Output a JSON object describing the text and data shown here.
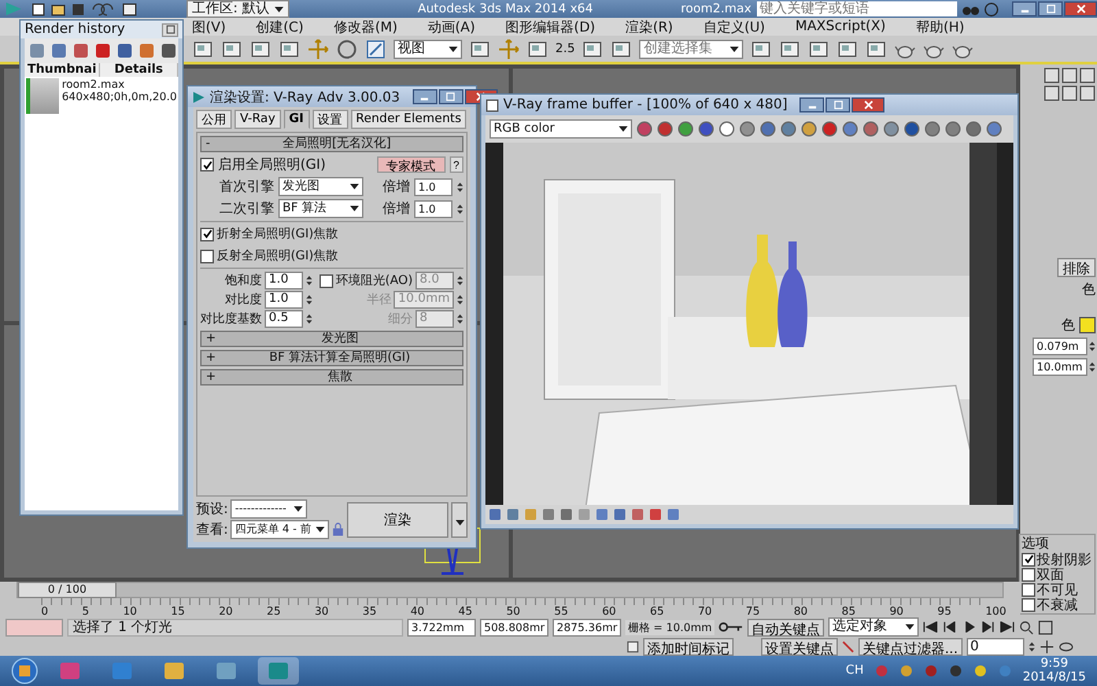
{
  "app": {
    "workspace": "工作区: 默认",
    "title": "Autodesk 3ds Max  2014 x64",
    "file": "room2.max",
    "search": {
      "placeholder": "键入关键字或短语"
    }
  },
  "menu": [
    {
      "label": "图(V)"
    },
    {
      "label": "创建(C)"
    },
    {
      "label": "修改器(M)"
    },
    {
      "label": "动画(A)"
    },
    {
      "label": "图形编辑器(D)"
    },
    {
      "label": "渲染(R)"
    },
    {
      "label": "自定义(U)"
    },
    {
      "label": "MAXScript(X)"
    },
    {
      "label": "帮助(H)"
    }
  ],
  "toolbar": {
    "view": "视图",
    "snap": "2.5",
    "selection_set": {
      "placeholder": "创建选择集"
    }
  },
  "render_history": {
    "title": "Render history",
    "columns": [
      "Thumbnai",
      "Details"
    ],
    "rows": [
      {
        "name": "room2.max",
        "details": "640x480;0h,0m,20.0"
      }
    ]
  },
  "render_settings": {
    "title": "渲染设置: V-Ray Adv 3.00.03",
    "tabs": [
      {
        "label": "公用",
        "selected": false
      },
      {
        "label": "V-Ray",
        "selected": false
      },
      {
        "label": "GI",
        "selected": true
      },
      {
        "label": "设置",
        "selected": false
      },
      {
        "label": "Render Elements",
        "selected": false
      }
    ],
    "rollout": {
      "toggle": "-",
      "title": "全局照明[无名汉化]"
    },
    "enable_gi": {
      "label": "启用全局照明(GI)",
      "checked": true
    },
    "expert_button": "专家模式",
    "help_button": "?",
    "engines": [
      {
        "label": "首次引擎",
        "value": "发光图",
        "mult_label": "倍增",
        "mult": "1.0"
      },
      {
        "label": "二次引擎",
        "value": "BF 算法",
        "mult_label": "倍增",
        "mult": "1.0"
      }
    ],
    "caustics": [
      {
        "label": "折射全局照明(GI)焦散",
        "checked": true
      },
      {
        "label": "反射全局照明(GI)焦散",
        "checked": false
      }
    ],
    "params": [
      {
        "label": "饱和度",
        "value": "1.0"
      },
      {
        "label": "对比度",
        "value": "1.0"
      },
      {
        "label": "对比度基数",
        "value": "0.5"
      }
    ],
    "ao": {
      "label": "环境阻光(AO)",
      "checked": false,
      "value": "8.0",
      "radius_label": "半径",
      "radius": "10.0mm",
      "subdiv_label": "细分",
      "subdiv": "8"
    },
    "collapsed": [
      {
        "toggle": "+",
        "title": "发光图"
      },
      {
        "toggle": "+",
        "title": "BF 算法计算全局照明(GI)"
      },
      {
        "toggle": "+",
        "title": "焦散"
      }
    ],
    "preset": {
      "label": "预设:",
      "value": "-------------"
    },
    "view": {
      "label": "查看:",
      "value": "四元菜单 4 - 前"
    },
    "render_button": "渲染"
  },
  "frame_buffer": {
    "title": "V-Ray frame buffer - [100% of 640 x 480]",
    "channel": "RGB color"
  },
  "command_panel": {
    "exclude_button": "排除",
    "color_labels": [
      "色",
      "色"
    ],
    "fields": [
      "0.079m",
      "10.0mm"
    ],
    "options": {
      "title": "选项",
      "items": [
        {
          "label": "投射阴影",
          "checked": true
        },
        {
          "label": "双面",
          "checked": false
        },
        {
          "label": "不可见",
          "checked": false
        },
        {
          "label": "不衰减",
          "checked": false
        }
      ]
    }
  },
  "timeline": {
    "position": "0 / 100",
    "level": 0,
    "ticks": [
      "0",
      "5",
      "10",
      "15",
      "20",
      "25",
      "30",
      "35",
      "40",
      "45",
      "50",
      "55",
      "60",
      "65",
      "70",
      "75",
      "80",
      "85",
      "90",
      "95",
      "100"
    ]
  },
  "status": {
    "message": "选择了 1 个灯光",
    "x": "3.722mm",
    "y": "508.808mr",
    "z": "2875.36mr",
    "grid": "栅格 = 10.0mm",
    "add_time_tag": "添加时间标记",
    "auto_key": "自动关键点",
    "key_target": "选定对象",
    "set_key": "设置关键点",
    "key_filters": "关键点过滤器...",
    "frame": "0"
  },
  "taskbar": {
    "ime": "CH",
    "time": "9:59",
    "date": "2014/8/15"
  }
}
